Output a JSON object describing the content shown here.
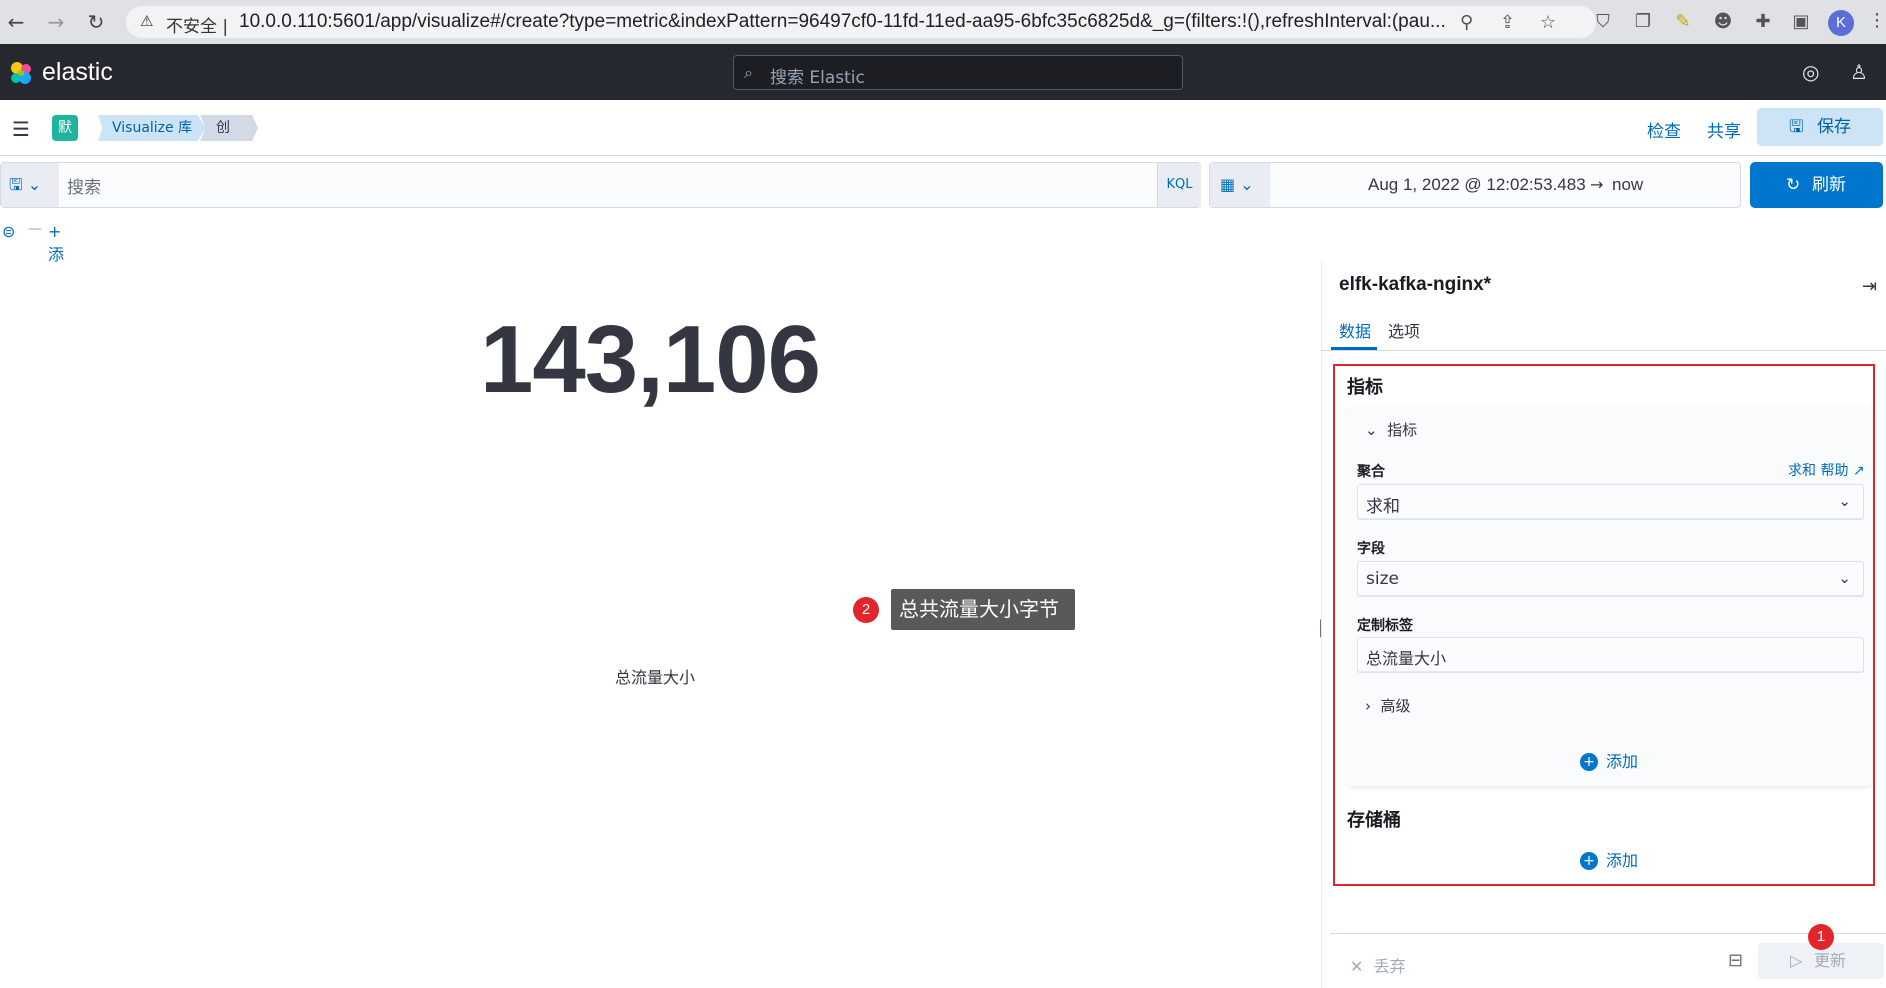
{
  "browser": {
    "insecure_label": "不安全 |",
    "url": "10.0.0.110:5601/app/visualize#/create?type=metric&indexPattern=96497cf0-11fd-11ed-aa95-6bfc35c6825d&_g=(filters:!(),refreshInterval:(pau...",
    "profile_initial": "K"
  },
  "header": {
    "logo_text": "elastic",
    "search_placeholder": "搜索 Elastic"
  },
  "breadcrumb": {
    "space": "默",
    "items": [
      "Visualize 库",
      "创建"
    ],
    "inspect_label": "检查",
    "share_label": "共享",
    "save_label": "保存"
  },
  "query": {
    "placeholder": "搜索",
    "language": "KQL",
    "date_start": "Aug 1, 2022 @ 12:02:53.483",
    "date_arrow": "→",
    "date_end": "now",
    "refresh_label": "刷新",
    "add_filter_label": "+ 添加筛选"
  },
  "visualization": {
    "metric_value": "143,106",
    "metric_label": "总流量大小",
    "annotation_badge": "2",
    "annotation_text": "总共流量大小字节"
  },
  "sidebar": {
    "index_title": "elfk-kafka-nginx*",
    "tabs": [
      "数据",
      "选项"
    ],
    "metrics_section_title": "指标",
    "metric_card_title": "指标",
    "aggregation_label": "聚合",
    "help_link": "求和 帮助",
    "aggregation_value": "求和",
    "field_label": "字段",
    "field_value": "size",
    "custom_label_label": "定制标签",
    "custom_label_value": "总流量大小",
    "advanced_label": "高级",
    "add_metric_label": "添加",
    "buckets_section_title": "存储桶",
    "add_bucket_label": "添加",
    "discard_label": "丢弃",
    "update_label": "更新",
    "update_annotation_badge": "1"
  },
  "colors": {
    "header_bg": "#25282f",
    "primary": "#0077cc",
    "annotation_red": "#e2252b",
    "link_blue": "#006bb8"
  }
}
